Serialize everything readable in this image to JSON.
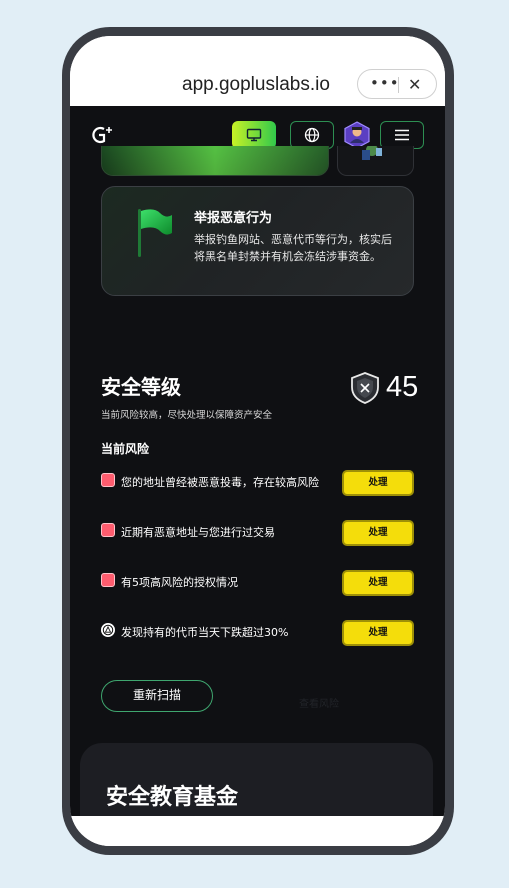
{
  "browser": {
    "url": "app.gopluslabs.io",
    "more_icon": "more-dots-icon",
    "close_icon": "close-icon"
  },
  "nav": {
    "logo": "goplus-logo",
    "monitor_icon": "monitor-icon",
    "globe_icon": "globe-icon",
    "avatar": "avatar",
    "menu_icon": "hamburger-menu-icon",
    "accent_gradient": [
      "#c8f226",
      "#32c94b"
    ]
  },
  "report": {
    "title": "举报恶意行为",
    "description": "举报钓鱼网站、恶意代币等行为，核实后将黑名单封禁并有机会冻结涉事资金。",
    "icon": "green-flag-icon"
  },
  "security": {
    "title": "安全等级",
    "subtitle": "当前风险较高，尽快处理以保障资产安全",
    "score": "45",
    "shield_icon": "shield-icon",
    "risk_heading": "当前风险",
    "risks": [
      {
        "text": "您的地址曾经被恶意投毒，存在较高风险",
        "icon": "warning-badge-icon",
        "action": "处理"
      },
      {
        "text": "近期有恶意地址与您进行过交易",
        "icon": "warning-badge-icon",
        "action": "处理"
      },
      {
        "text": "有5项高风险的授权情况",
        "icon": "warning-badge-icon",
        "action": "处理"
      },
      {
        "text": "发现持有的代币当天下跌超过30%",
        "icon": "alert-circle-icon",
        "action": "处理"
      }
    ],
    "rescan_label": "重新扫描",
    "ghost_label": "查看风险",
    "button_color": "#f4dd0b",
    "risk_color": "#ff5d6f"
  },
  "education": {
    "title": "安全教育基金"
  }
}
